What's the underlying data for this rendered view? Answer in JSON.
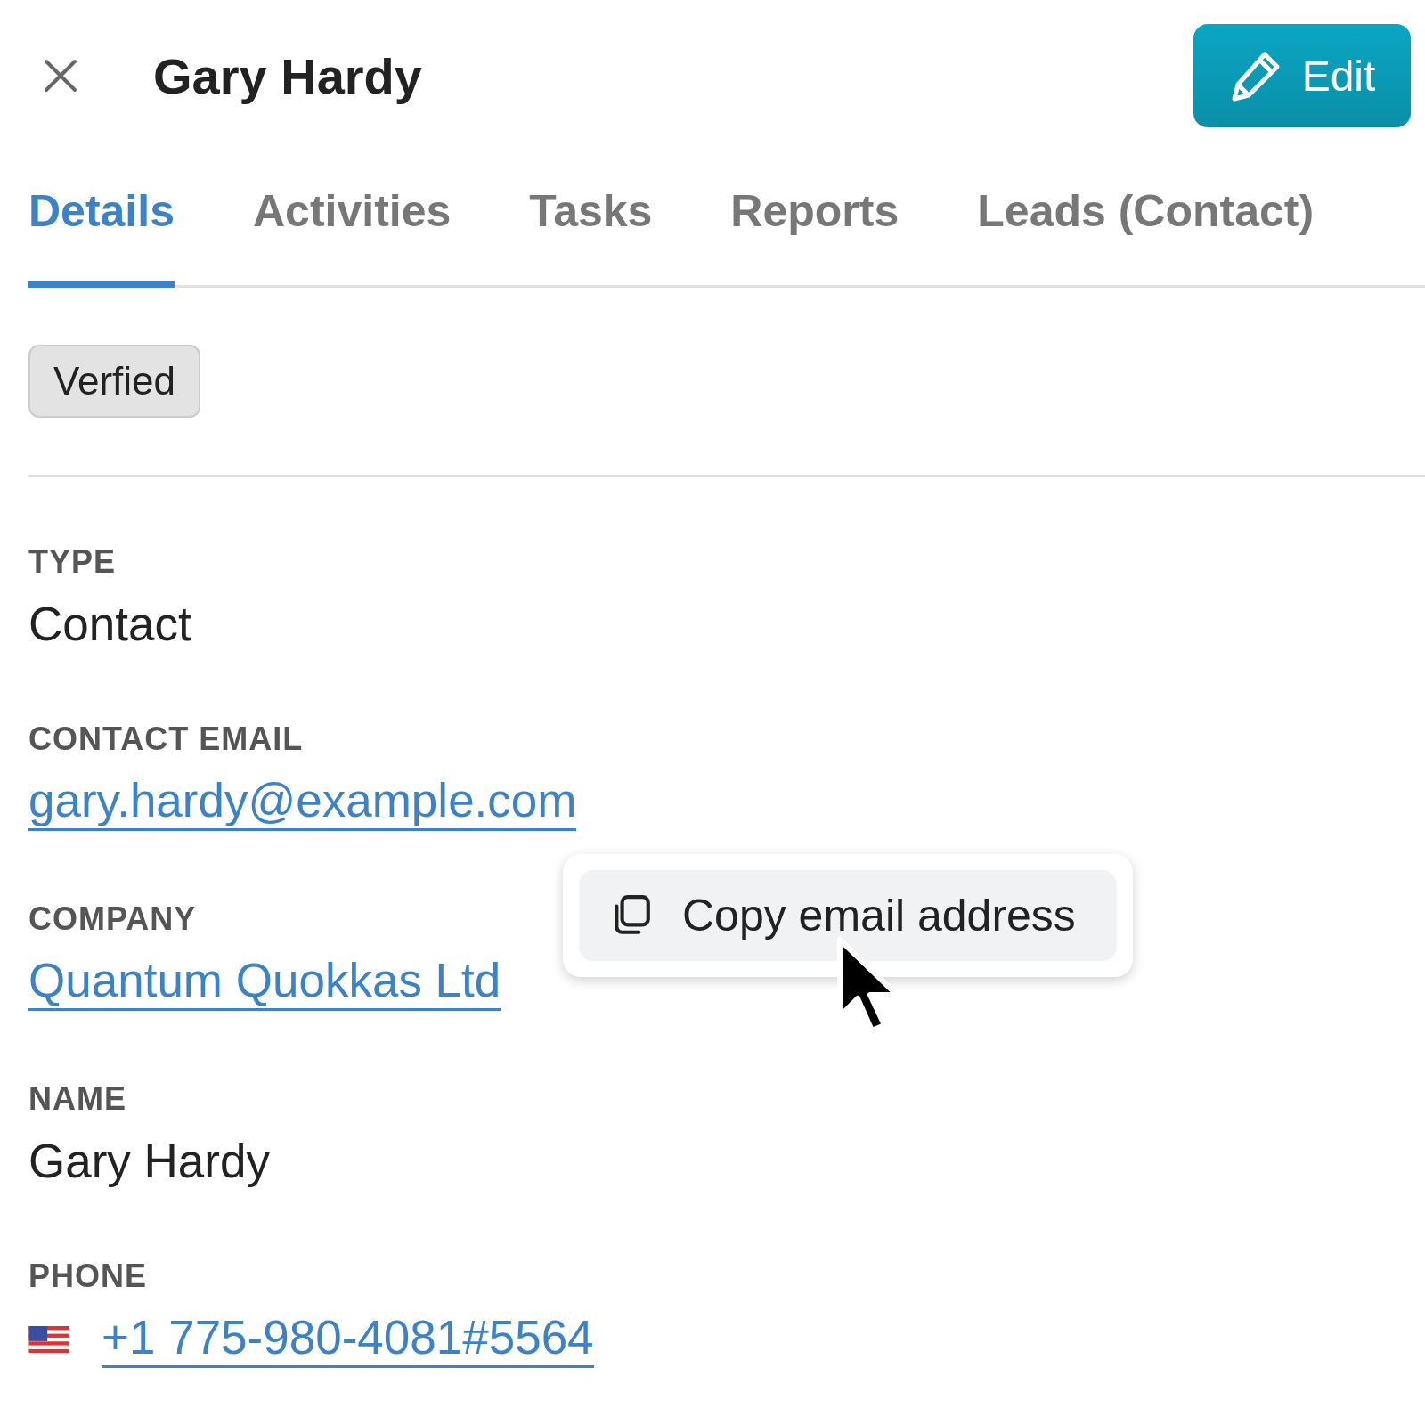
{
  "header": {
    "title": "Gary Hardy",
    "edit_button": "Edit"
  },
  "tabs": [
    {
      "label": "Details",
      "selected": true
    },
    {
      "label": "Activities",
      "selected": false
    },
    {
      "label": "Tasks",
      "selected": false
    },
    {
      "label": "Reports",
      "selected": false
    },
    {
      "label": "Leads (Contact)",
      "selected": false
    }
  ],
  "badge": "Verfied",
  "fields": [
    {
      "label": "TYPE",
      "value": "Contact",
      "kind": "text"
    },
    {
      "label": "CONTACT EMAIL",
      "value": "gary.hardy@example.com",
      "kind": "link",
      "popup": {
        "label": "Copy email address"
      }
    },
    {
      "label": "COMPANY",
      "value": "Quantum Quokkas Ltd",
      "kind": "link"
    },
    {
      "label": "NAME",
      "value": "Gary Hardy",
      "kind": "text"
    },
    {
      "label": "PHONE",
      "value": "+1 775-980-4081#5564",
      "kind": "phone"
    }
  ]
}
